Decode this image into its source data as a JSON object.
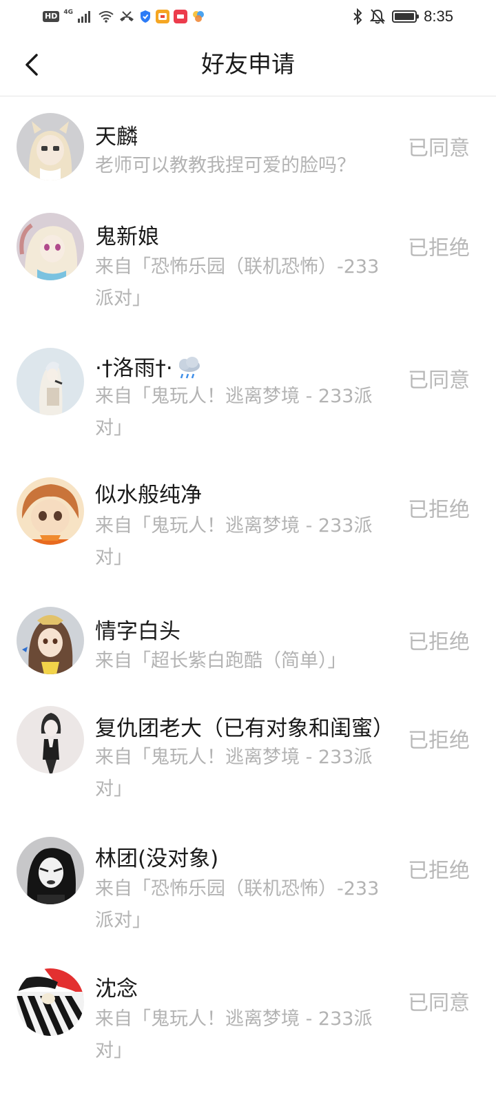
{
  "status_bar": {
    "hd": "HD",
    "network": "4G",
    "time": "8:35",
    "icons": [
      "hd-icon",
      "signal-icon",
      "wifi-icon",
      "missed-call-icon",
      "shield-app-icon",
      "app-icon",
      "xiaomi-app-icon",
      "pinwheel-app-icon",
      "bluetooth-icon",
      "mute-icon",
      "battery-icon"
    ]
  },
  "header": {
    "title": "好友申请",
    "back_icon": "chevron-left-icon"
  },
  "requests": [
    {
      "name": "天麟",
      "message": "老师可以教教我捏可爱的脸吗？",
      "status": "已同意"
    },
    {
      "name": "鬼新娘",
      "message": "来自「恐怖乐园（联机恐怖）-233派对」",
      "status": "已拒绝"
    },
    {
      "name": "·†洛雨†·",
      "message": "来自「鬼玩人！逃离梦境 - 233派对」",
      "status": "已同意",
      "emoji": "rain-cloud-icon"
    },
    {
      "name": "似水般纯净",
      "message": "来自「鬼玩人！逃离梦境 - 233派对」",
      "status": "已拒绝"
    },
    {
      "name": "情字白头",
      "message": "来自「超长紫白跑酷（简单）」",
      "status": "已拒绝"
    },
    {
      "name": "复仇团老大（已有对象和闺蜜）",
      "message": "来自「鬼玩人！逃离梦境 - 233派对」",
      "status": "已拒绝"
    },
    {
      "name": "林团(没对象)",
      "message": "来自「恐怖乐园（联机恐怖）-233派对」",
      "status": "已拒绝"
    },
    {
      "name": "沈念",
      "message": "来自「鬼玩人！逃离梦境 - 233派对」",
      "status": "已同意"
    }
  ],
  "colors": {
    "background": "#ffffff",
    "title": "#1a1a1a",
    "secondary_text": "#b3b3b3",
    "status_text": "#b8b8b8",
    "divider": "#e6e6e6"
  }
}
